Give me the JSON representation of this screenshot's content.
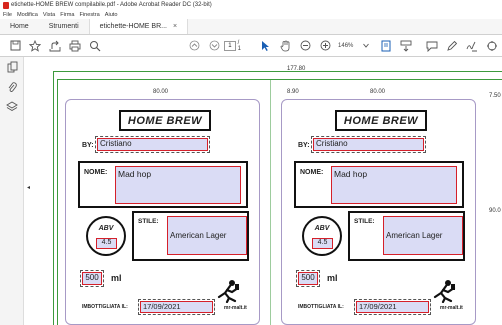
{
  "window": {
    "title": "etichette-HOME BREW compilabile.pdf - Adobe Acrobat Reader DC (32-bit)"
  },
  "menu": {
    "file": "File",
    "edit": "Modifica",
    "view": "Vista",
    "sign": "Firma",
    "window": "Finestra",
    "help": "Aiuto"
  },
  "tabs": {
    "home": "Home",
    "tools": "Strumenti",
    "document": "etichette-HOME BR...",
    "document_close": "×"
  },
  "toolbar": {
    "page_current": "1",
    "page_total": "/ 1",
    "zoom": "146%"
  },
  "dimensions": {
    "page_width": "177.80",
    "label_width_left": "80.00",
    "gap": "8.90",
    "label_width_right": "80.00",
    "top_margin": "7.50",
    "label_height": "90.0"
  },
  "labels": [
    {
      "brand": "HOME BREW",
      "by_label": "BY:",
      "by_value": "Cristiano",
      "nome_label": "NOME:",
      "nome_value": "Mad hop",
      "abv_label": "ABV",
      "abv_value": "4.5",
      "stile_label": "STILE:",
      "stile_value": "American Lager",
      "ml_value": "500",
      "ml_unit": "ml",
      "imbottigliata_label": "IMBOTTIGLIATA IL:",
      "imbottigliata_value": "17/09/2021",
      "logo_text": "mr-malt.it"
    },
    {
      "brand": "HOME BREW",
      "by_label": "BY:",
      "by_value": "Cristiano",
      "nome_label": "NOME:",
      "nome_value": "Mad hop",
      "abv_label": "ABV",
      "abv_value": "4.5",
      "stile_label": "STILE:",
      "stile_value": "American Lager",
      "ml_value": "500",
      "ml_unit": "ml",
      "imbottigliata_label": "IMBOTTIGLIATA IL:",
      "imbottigliata_value": "17/09/2021",
      "logo_text": "mr-malt.it"
    }
  ],
  "colors": {
    "field_fill": "#dadcf5",
    "field_border": "#d5202a",
    "label_border": "#a79ac6",
    "dimension_line": "#3c9a3c",
    "pdf_icon": "#d7261e"
  },
  "icons": {
    "toolbar": [
      "save-icon",
      "star-icon",
      "share-icon",
      "print-icon",
      "search-icon",
      "page-up-icon",
      "page-down-icon",
      "cursor-icon",
      "hand-icon",
      "zoom-out-icon",
      "zoom-in-icon",
      "fit-page-icon",
      "scroll-icon",
      "comment-icon",
      "highlight-icon",
      "sign-icon",
      "share-link-icon"
    ],
    "left_panel": [
      "page-thumbnails-icon",
      "attachments-icon",
      "layers-icon"
    ]
  }
}
